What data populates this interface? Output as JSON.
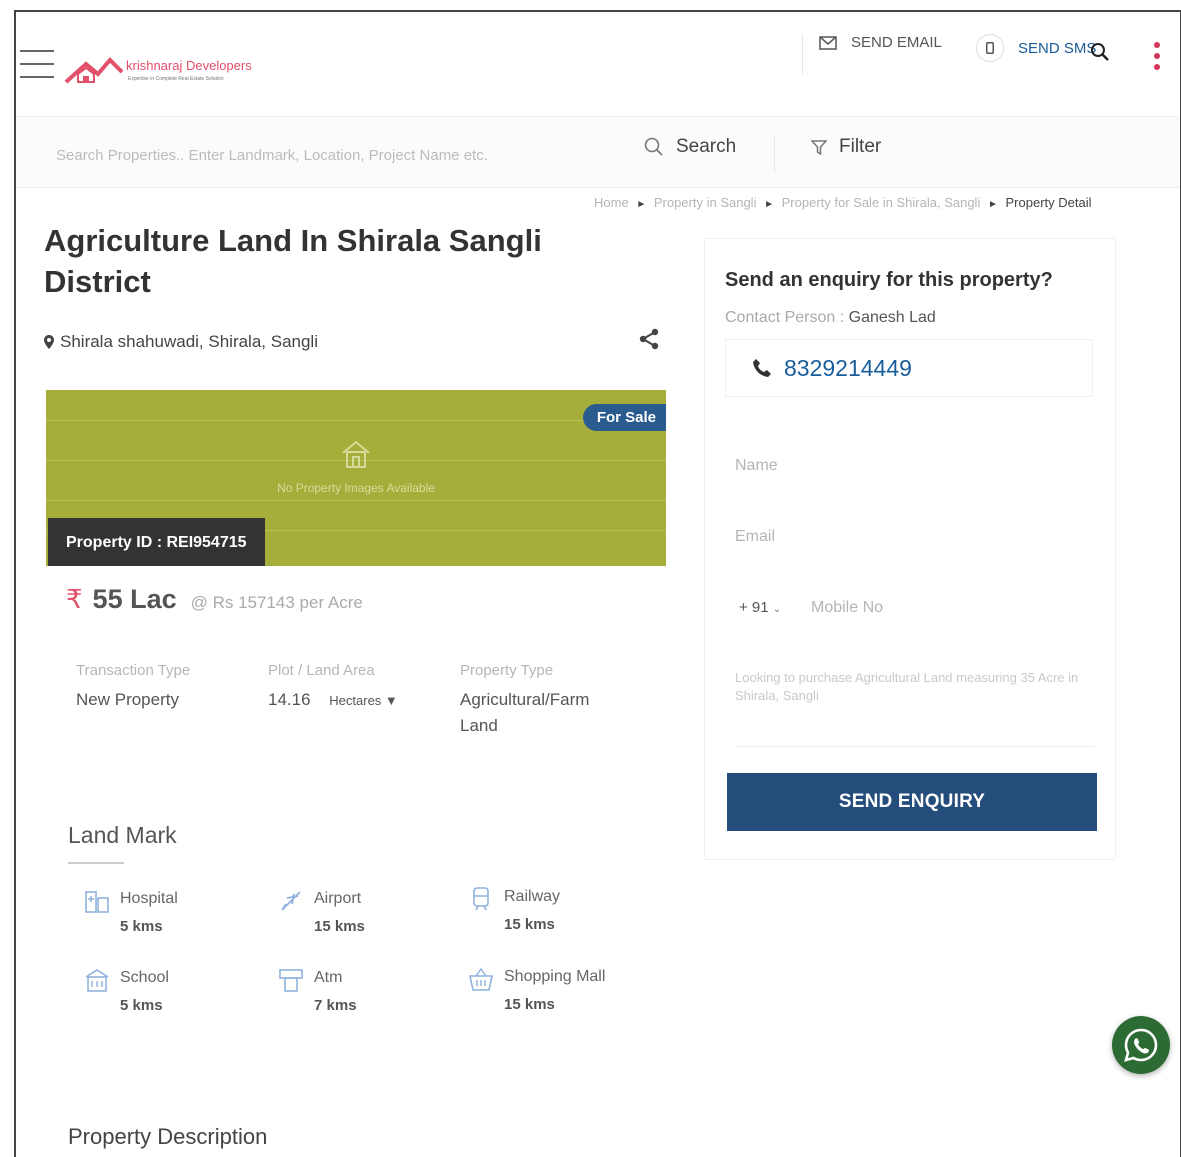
{
  "header": {
    "brand": "krishnaraj Developers",
    "brand_tagline": "Expertise in Complete Real Estate Solution",
    "send_email_label": "SEND EMAIL",
    "send_sms_label": "SEND SMS"
  },
  "search": {
    "placeholder": "Search Properties.. Enter Landmark, Location, Project Name etc.",
    "search_label": "Search",
    "filter_label": "Filter"
  },
  "breadcrumb": {
    "items": [
      "Home",
      "Property in Sangli",
      "Property for Sale in Shirala, Sangli"
    ],
    "current": "Property Detail"
  },
  "property": {
    "title": "Agriculture Land In Shirala Sangli District",
    "location": "Shirala shahuwadi, Shirala, Sangli",
    "badge": "For Sale",
    "no_image_text": "No Property Images Available",
    "property_id": "Property ID : REI954715",
    "price_symbol": "₹",
    "price": "55 Lac",
    "price_per": "@ Rs 157143 per Acre",
    "specs": {
      "transaction_label": "Transaction Type",
      "transaction_value": "New Property",
      "area_label": "Plot / Land Area",
      "area_value": "14.16",
      "area_unit": "Hectares ▼",
      "type_label": "Property Type",
      "type_value": "Agricultural/Farm Land"
    }
  },
  "landmark": {
    "heading": "Land Mark",
    "items": [
      {
        "name": "Hospital",
        "distance": "5 kms",
        "icon": "hospital-icon"
      },
      {
        "name": "Airport",
        "distance": "15 kms",
        "icon": "airport-icon"
      },
      {
        "name": "Railway",
        "distance": "15 kms",
        "icon": "railway-icon"
      },
      {
        "name": "School",
        "distance": "5 kms",
        "icon": "school-icon"
      },
      {
        "name": "Atm",
        "distance": "7 kms",
        "icon": "atm-icon"
      },
      {
        "name": "Shopping Mall",
        "distance": "15 kms",
        "icon": "shopping-mall-icon"
      }
    ]
  },
  "description": {
    "heading": "Property Description"
  },
  "enquiry": {
    "title": "Send an enquiry for this property?",
    "contact_label": "Contact Person : ",
    "contact_name": "Ganesh Lad",
    "phone": "8329214449",
    "name_placeholder": "Name",
    "email_placeholder": "Email",
    "country_code": "+ 91",
    "mobile_placeholder": "Mobile No",
    "message_placeholder": "Looking to purchase Agricultural Land measuring 35 Acre in Shirala, Sangli",
    "submit_label": "SEND ENQUIRY"
  },
  "colors": {
    "brand_red": "#e2506a",
    "primary_blue": "#254d7c",
    "link_blue": "#1a5d9b",
    "image_green": "#a6ae3b",
    "whatsapp_green": "#2d6b34"
  }
}
